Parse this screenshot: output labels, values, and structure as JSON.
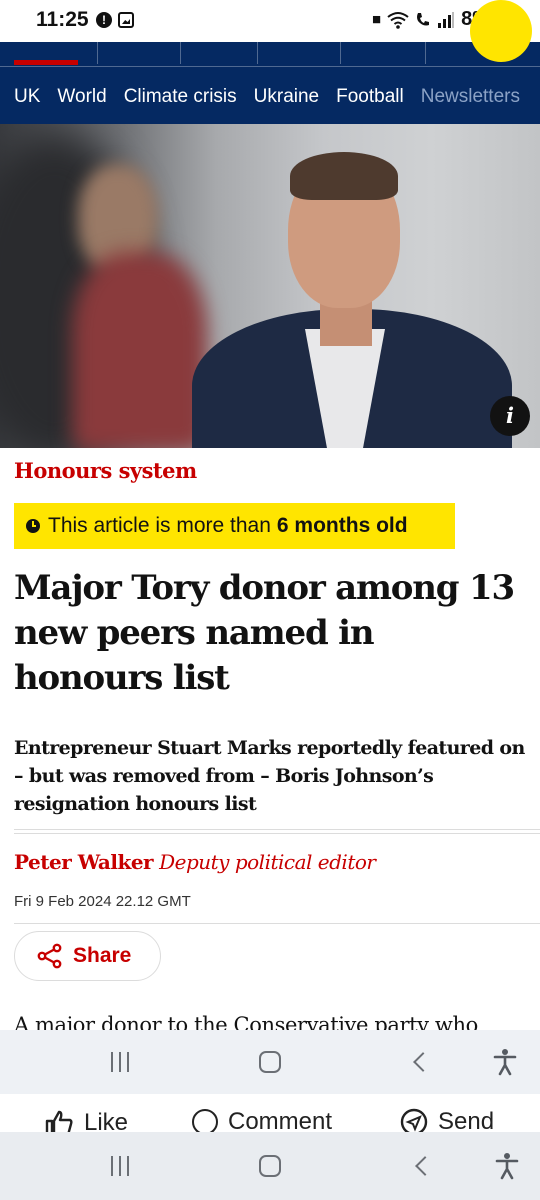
{
  "status_bar": {
    "time": "11:25",
    "battery": "8%"
  },
  "site_nav": {
    "items": [
      "UK",
      "World",
      "Climate crisis",
      "Ukraine",
      "Football",
      "Newsletters"
    ]
  },
  "hero_image": {
    "info_label": "i"
  },
  "article": {
    "kicker": "Honours system",
    "age_warning_prefix": "This article is more than",
    "age_warning_emphasis": "6 months old",
    "headline": "Major Tory donor among 13 new peers named in honours list",
    "standfirst": "Entrepreneur Stuart Marks reportedly featured on – but was removed from – Boris Johnson’s resignation honours list",
    "author": "Peter Walker",
    "author_role": "Deputy political editor",
    "date": "Fri 9 Feb 2024 22.12 GMT",
    "share_label": "Share",
    "body_start": "A major donor to the Conservative party who"
  },
  "facebook_bar": {
    "like": "Like",
    "comment": "Comment",
    "send": "Send"
  },
  "colors": {
    "guardian_blue": "#052962",
    "news_red": "#c70000",
    "warning_yellow": "#ffe500"
  },
  "icons": [
    "alert-icon",
    "gallery-icon",
    "wifi-icon",
    "signal-icon",
    "battery-icon",
    "clock-icon",
    "share-icon",
    "info-icon",
    "like-icon",
    "comment-icon",
    "send-icon",
    "recents-icon",
    "home-icon",
    "back-icon",
    "accessibility-icon"
  ]
}
